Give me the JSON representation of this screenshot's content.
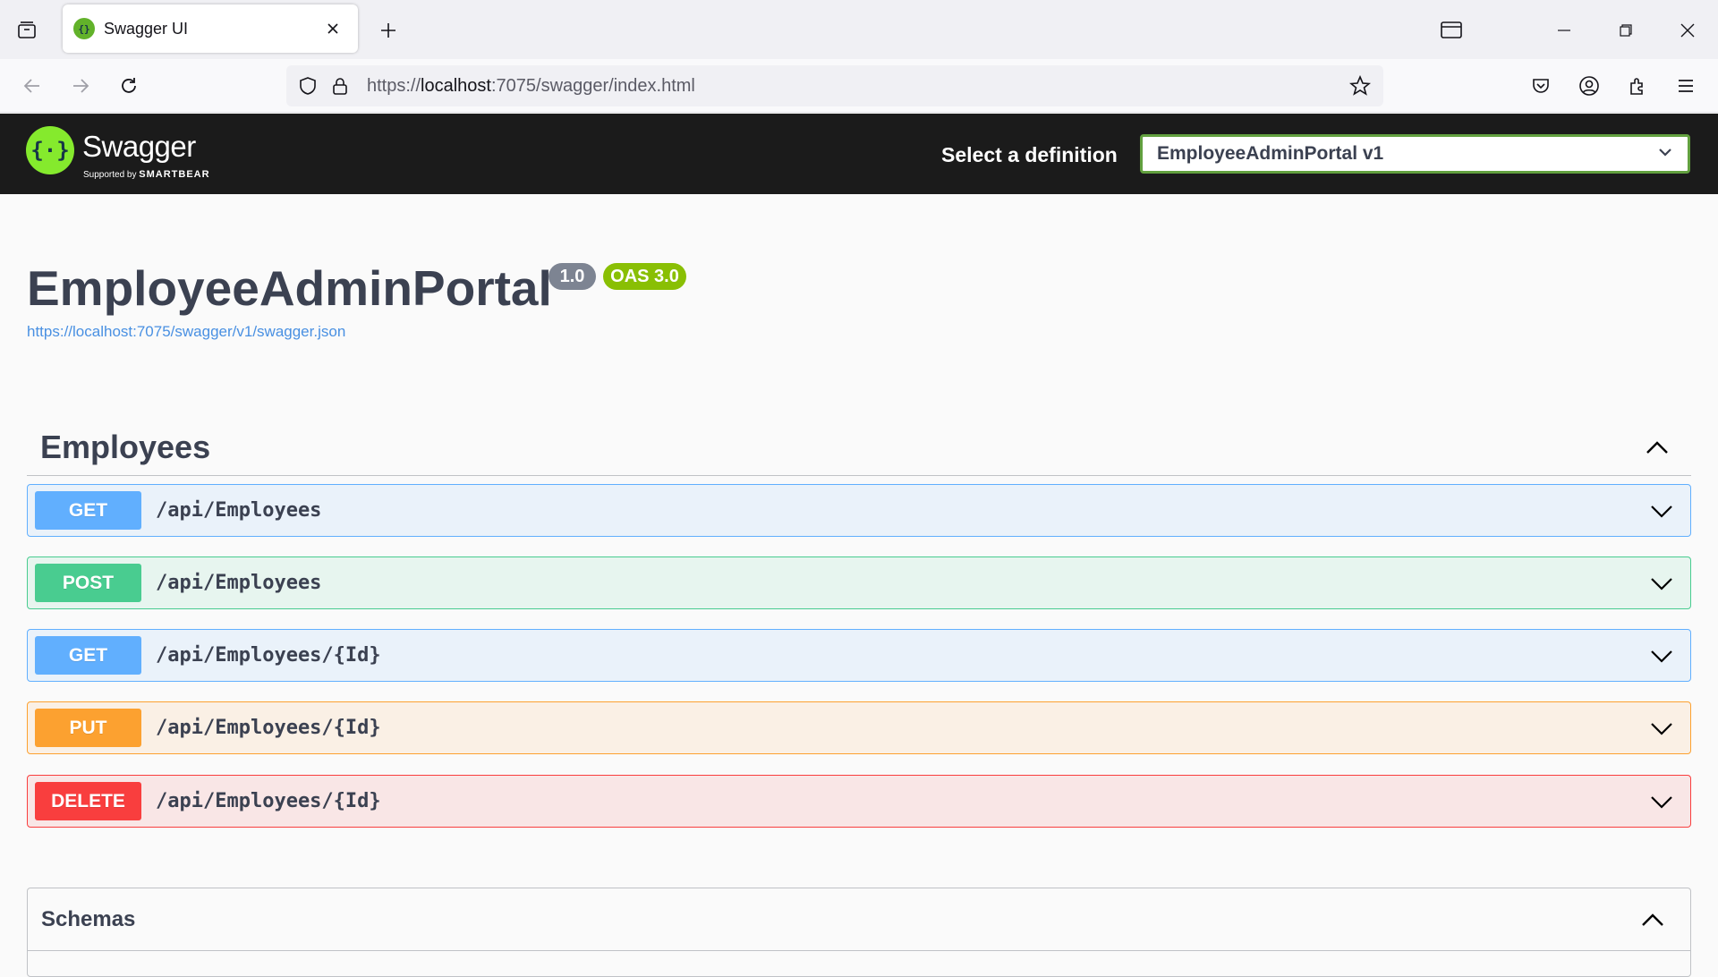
{
  "browser": {
    "tab_title": "Swagger UI",
    "url_prefix": "https://",
    "url_host": "localhost",
    "url_rest": ":7075/swagger/index.html"
  },
  "topbar": {
    "logo_text": "Swagger",
    "logo_sub_prefix": "Supported by",
    "logo_sub_brand": "SMARTBEAR",
    "definition_label": "Select a definition",
    "definition_value": "EmployeeAdminPortal v1"
  },
  "info": {
    "title": "EmployeeAdminPortal",
    "version": "1.0",
    "oas": "OAS 3.0",
    "spec_url": "https://localhost:7075/swagger/v1/swagger.json"
  },
  "tag": {
    "name": "Employees"
  },
  "operations": [
    {
      "method": "GET",
      "path": "/api/Employees"
    },
    {
      "method": "POST",
      "path": "/api/Employees"
    },
    {
      "method": "GET",
      "path": "/api/Employees/{Id}"
    },
    {
      "method": "PUT",
      "path": "/api/Employees/{Id}"
    },
    {
      "method": "DELETE",
      "path": "/api/Employees/{Id}"
    }
  ],
  "schemas": {
    "title": "Schemas"
  },
  "colors": {
    "get": "#61affe",
    "post": "#49cc90",
    "put": "#fca130",
    "delete": "#f93e3e",
    "swagger_green": "#85ea2d",
    "topbar": "#1b1b1b"
  }
}
